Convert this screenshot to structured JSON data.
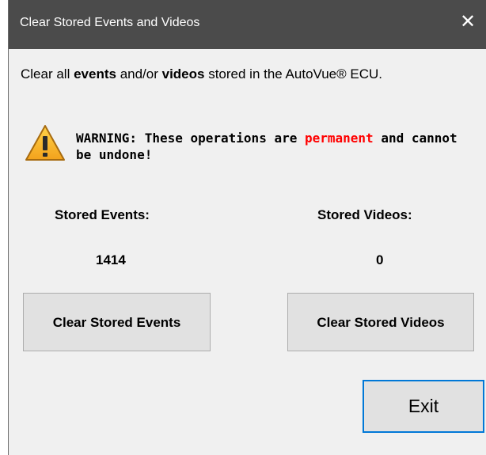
{
  "window": {
    "title": "Clear Stored Events and Videos"
  },
  "intro": {
    "part1": "Clear all ",
    "bold1": "events",
    "part2": " and/or ",
    "bold2": "videos",
    "part3": " stored in the AutoVue® ECU."
  },
  "warning": {
    "prefix": "WARNING: These operations are ",
    "highlight": "permanent",
    "suffix": " and cannot be undone!",
    "highlight_color": "#ff0000",
    "icon": "warning-triangle-icon"
  },
  "events": {
    "label": "Stored Events:",
    "count": "1414",
    "button_label": "Clear Stored Events"
  },
  "videos": {
    "label": "Stored Videos:",
    "count": "0",
    "button_label": "Clear Stored Videos"
  },
  "exit_label": "Exit",
  "colors": {
    "titlebar": "#4b4b4b",
    "focus_border": "#0078d7",
    "background": "#f0f0f0"
  }
}
